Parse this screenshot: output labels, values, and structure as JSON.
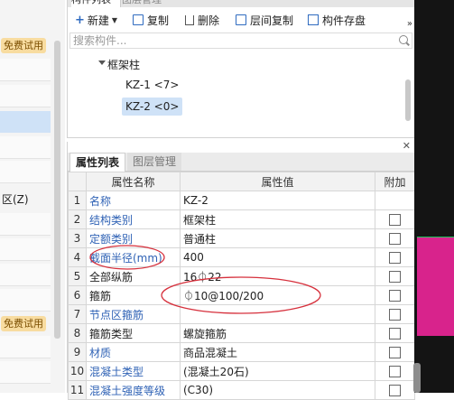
{
  "left": {
    "badge_top": "免费试用",
    "badge_bottom": "免费试用",
    "partial_text": "区(Z)"
  },
  "top_panel": {
    "tab_active": "构件列表",
    "tab_inactive": "图层管理",
    "toolbar": {
      "new_label": "新建",
      "copy_label": "复制",
      "delete_label": "删除",
      "floor_copy_label": "层间复制",
      "save_label": "构件存盘",
      "more_icon": "double-chevron-right-icon"
    },
    "search_placeholder": "搜索构件...",
    "tree": {
      "root_label": "框架柱",
      "items": [
        {
          "label": "KZ-1 <7>",
          "selected": false
        },
        {
          "label": "KZ-2 <0>",
          "selected": true
        }
      ]
    }
  },
  "bottom_panel": {
    "tabs": [
      "属性列表",
      "图层管理"
    ],
    "columns": [
      "属性名称",
      "属性值",
      "附加"
    ],
    "rows": [
      {
        "num": "1",
        "name": "名称",
        "value": "KZ-2",
        "has_check": false,
        "name_style": "link"
      },
      {
        "num": "2",
        "name": "结构类别",
        "value": "框架柱",
        "has_check": true,
        "name_style": "link"
      },
      {
        "num": "3",
        "name": "定额类别",
        "value": "普通柱",
        "has_check": true,
        "name_style": "link"
      },
      {
        "num": "4",
        "name": "截面半径(mm)",
        "value": "400",
        "has_check": true,
        "name_style": "link"
      },
      {
        "num": "5",
        "name": "全部纵筋",
        "value": "16⏀22",
        "has_check": true,
        "name_style": "plain"
      },
      {
        "num": "6",
        "name": "箍筋",
        "value": "⏀10@100/200",
        "has_check": true,
        "name_style": "plain"
      },
      {
        "num": "7",
        "name": "节点区箍筋",
        "value": "",
        "has_check": true,
        "name_style": "link"
      },
      {
        "num": "8",
        "name": "箍筋类型",
        "value": "螺旋箍筋",
        "has_check": true,
        "name_style": "plain"
      },
      {
        "num": "9",
        "name": "材质",
        "value": "商品混凝土",
        "has_check": true,
        "name_style": "link"
      },
      {
        "num": "10",
        "name": "混凝土类型",
        "value": "(混凝土20石)",
        "has_check": true,
        "name_style": "link"
      },
      {
        "num": "11",
        "name": "混凝土强度等级",
        "value": "(C30)",
        "has_check": true,
        "name_style": "link"
      }
    ]
  },
  "colors": {
    "link": "#2f62b5",
    "selection": "#cfe2f7",
    "annotation": "#d6303c",
    "magenta": "#d8238c"
  }
}
